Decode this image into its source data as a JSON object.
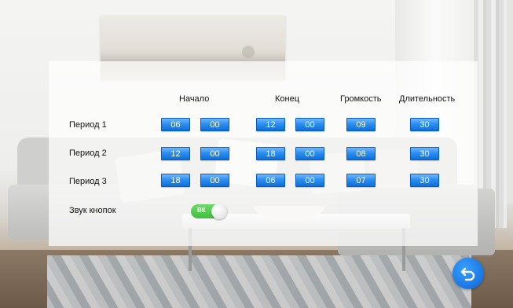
{
  "columns": {
    "start": "Начало",
    "end": "Конец",
    "volume": "Громкость",
    "duration": "Длительность"
  },
  "periods": [
    {
      "label": "Период 1",
      "start_h": "06",
      "start_m": "00",
      "end_h": "12",
      "end_m": "00",
      "volume": "09",
      "duration": "30"
    },
    {
      "label": "Период 2",
      "start_h": "12",
      "start_m": "00",
      "end_h": "18",
      "end_m": "00",
      "volume": "08",
      "duration": "30"
    },
    {
      "label": "Период 3",
      "start_h": "18",
      "start_m": "00",
      "end_h": "06",
      "end_m": "00",
      "volume": "07",
      "duration": "30"
    }
  ],
  "key_sound": {
    "label": "Звук кнопок",
    "toggle_text": "ВК",
    "state": "on"
  },
  "icons": {
    "back": "back-arrow-icon"
  },
  "colors": {
    "value_box": "#1a7ee6",
    "toggle_on": "#4cc649",
    "back_button": "#1576e0"
  }
}
